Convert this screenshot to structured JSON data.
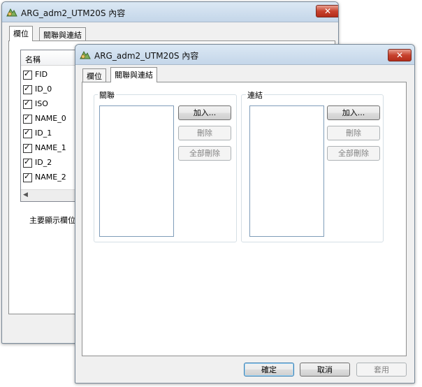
{
  "back_window": {
    "title": "ARG_adm2_UTM20S 內容",
    "tabs": [
      "欄位",
      "關聯與連結"
    ],
    "field_list": {
      "header": "名稱",
      "rows": [
        {
          "label": "FID",
          "checked": true
        },
        {
          "label": "ID_0",
          "checked": true
        },
        {
          "label": "ISO",
          "checked": true
        },
        {
          "label": "NAME_0",
          "checked": true
        },
        {
          "label": "ID_1",
          "checked": true
        },
        {
          "label": "NAME_1",
          "checked": true
        },
        {
          "label": "ID_2",
          "checked": true
        },
        {
          "label": "NAME_2",
          "checked": true
        }
      ]
    },
    "primary_display_label": "主要顯示欄位"
  },
  "front_window": {
    "title": "ARG_adm2_UTM20S 內容",
    "tabs": [
      "欄位",
      "關聯與連結"
    ],
    "active_tab": "關聯與連結",
    "relates": {
      "label": "關聯",
      "add": "加入...",
      "remove": "刪除",
      "remove_all": "全部刪除"
    },
    "joins": {
      "label": "連結",
      "add": "加入...",
      "remove": "刪除",
      "remove_all": "全部刪除"
    },
    "footer": {
      "ok": "確定",
      "cancel": "取消",
      "apply": "套用"
    }
  }
}
